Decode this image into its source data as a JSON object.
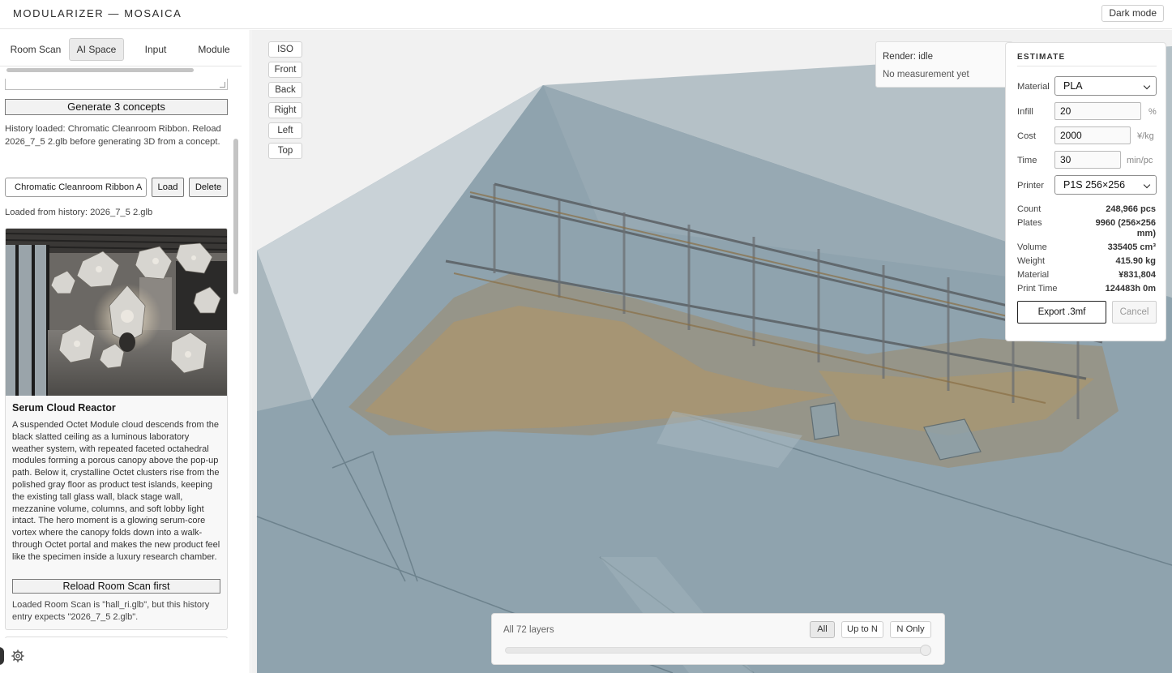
{
  "app": {
    "title": "MODULARIZER — MOSAICA",
    "dark_mode_label": "Dark mode"
  },
  "sidebar": {
    "tabs": [
      {
        "label": "Room Scan",
        "active": false
      },
      {
        "label": "AI Space",
        "active": true
      },
      {
        "label": "Input",
        "active": false
      },
      {
        "label": "Module",
        "active": false
      }
    ],
    "generate_label": "Generate 3 concepts",
    "history_note": "History loaded: Chromatic Cleanroom Ribbon. Reload 2026_7_5 2.glb before generating 3D from a concept.",
    "history_select_value": "Chromatic Cleanroom Ribbon A",
    "load_label": "Load",
    "delete_label": "Delete",
    "loaded_from": "Loaded from history: 2026_7_5 2.glb",
    "concept": {
      "title": "Serum Cloud Reactor",
      "description": "A suspended Octet Module cloud descends from the black slatted ceiling as a luminous laboratory weather system, with repeated faceted octahedral modules forming a porous canopy above the pop-up path. Below it, crystalline Octet clusters rise from the polished gray floor as product test islands, keeping the existing tall glass wall, black stage wall, mezzanine volume, columns, and soft lobby light intact. The hero moment is a glowing serum-core vortex where the canopy folds down into a walk-through Octet portal and makes the new product feel like the specimen inside a luxury research chamber.",
      "reload_label": "Reload Room Scan first",
      "warning": "Loaded Room Scan is \"hall_ri.glb\", but this history entry expects \"2026_7_5 2.glb\"."
    }
  },
  "viewport": {
    "view_buttons": [
      "ISO",
      "Front",
      "Back",
      "Right",
      "Left",
      "Top"
    ],
    "render_status": "Render: idle",
    "measurement": "No measurement yet"
  },
  "estimate": {
    "heading": "ESTIMATE",
    "material_label": "Material",
    "material_value": "PLA",
    "infill_label": "Infill",
    "infill_value": "20",
    "infill_unit": "%",
    "cost_label": "Cost",
    "cost_value": "2000",
    "cost_unit": "¥/kg",
    "time_label": "Time",
    "time_value": "30",
    "time_unit": "min/pc",
    "printer_label": "Printer",
    "printer_value": "P1S 256×256",
    "stats": [
      {
        "label": "Count",
        "value": "248,966 pcs"
      },
      {
        "label": "Plates",
        "value": "9960 (256×256 mm)"
      },
      {
        "label": "Volume",
        "value": "335405 cm³"
      },
      {
        "label": "Weight",
        "value": "415.90 kg"
      },
      {
        "label": "Material",
        "value": "¥831,804"
      },
      {
        "label": "Print Time",
        "value": "124483h 0m"
      }
    ],
    "export_label": "Export .3mf",
    "cancel_label": "Cancel"
  },
  "layers": {
    "label": "All 72 layers",
    "buttons": [
      "All",
      "Up to N",
      "N Only"
    ],
    "active": "All",
    "slider_fraction": 1.0
  }
}
